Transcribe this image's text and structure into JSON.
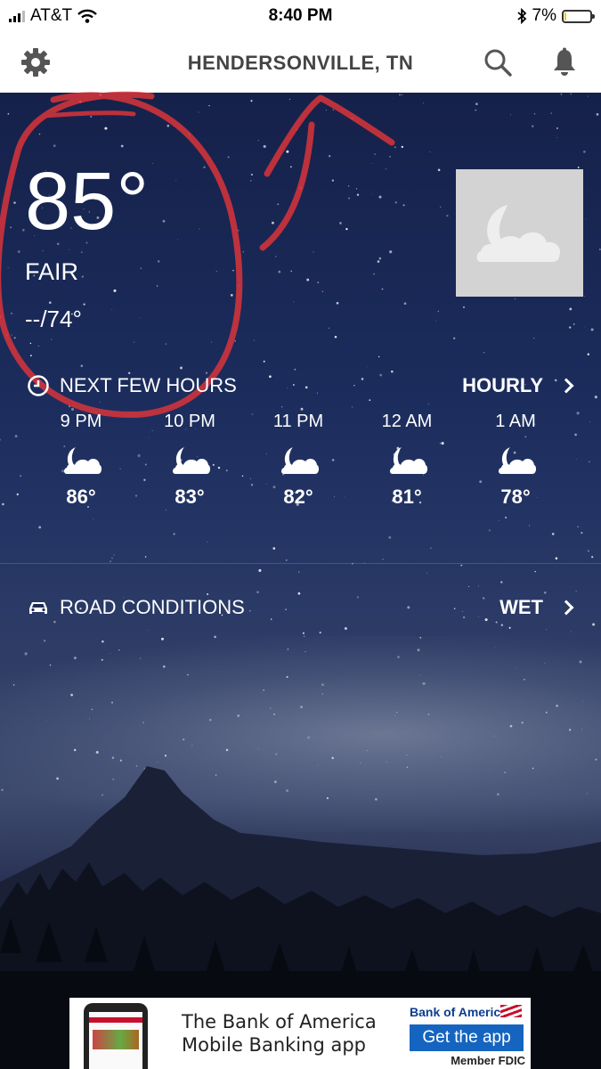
{
  "status_bar": {
    "carrier": "AT&T",
    "time": "8:40 PM",
    "battery": "7%",
    "battery_level": 0.07,
    "battery_color": "#f2c800"
  },
  "header": {
    "title": "HENDERSONVILLE, TN",
    "settings_icon": "gear-icon",
    "search_icon": "search-icon",
    "alerts_icon": "bell-icon"
  },
  "current": {
    "temperature": "85°",
    "condition": "FAIR",
    "hi_lo": "--/74°",
    "icon": "moon-cloud-icon"
  },
  "next_hours": {
    "label": "NEXT FEW HOURS",
    "link": "HOURLY",
    "hours": [
      {
        "time": "9 PM",
        "temp": "86°"
      },
      {
        "time": "10 PM",
        "temp": "83°"
      },
      {
        "time": "11 PM",
        "temp": "82°"
      },
      {
        "time": "12 AM",
        "temp": "81°"
      },
      {
        "time": "1 AM",
        "temp": "78°"
      }
    ]
  },
  "road": {
    "label": "ROAD CONDITIONS",
    "value": "WET"
  },
  "ad": {
    "line1": "The Bank of America",
    "line2": "Mobile Banking app",
    "brand": "Bank of America",
    "cta": "Get the app",
    "fdic": "Member FDIC"
  },
  "colors": {
    "annotation": "#d9343a",
    "ad_button": "#1565c0"
  }
}
